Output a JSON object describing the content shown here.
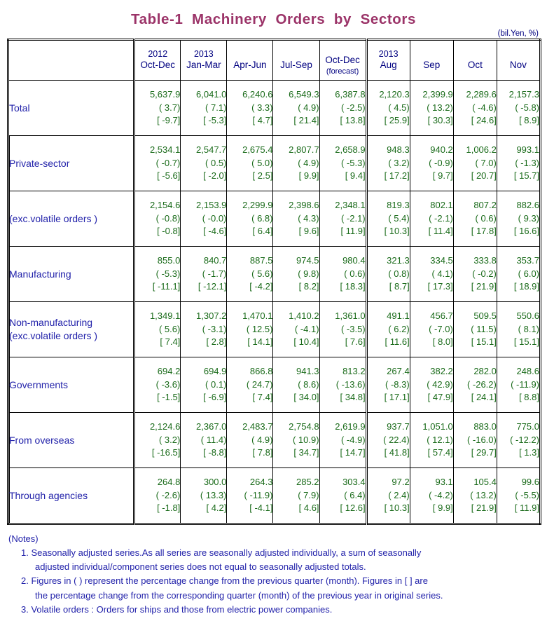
{
  "title": "Table-1  Machinery  Orders  by  Sectors",
  "unit_note": "(bil.Yen, %)",
  "header": {
    "blank": "",
    "columns": [
      {
        "year": "2012",
        "period": "Oct-Dec",
        "note": ""
      },
      {
        "year": "2013",
        "period": "Jan-Mar",
        "note": ""
      },
      {
        "year": "",
        "period": "Apr-Jun",
        "note": ""
      },
      {
        "year": "",
        "period": "Jul-Sep",
        "note": ""
      },
      {
        "year": "",
        "period": "Oct-Dec",
        "note": "(forecast)"
      },
      {
        "year": "2013",
        "period": "Aug",
        "note": ""
      },
      {
        "year": "",
        "period": "Sep",
        "note": ""
      },
      {
        "year": "",
        "period": "Oct",
        "note": ""
      },
      {
        "year": "",
        "period": "Nov",
        "note": ""
      }
    ]
  },
  "rows": [
    {
      "id": "total",
      "label": "Total",
      "label2": "",
      "indent": 0,
      "cells": [
        {
          "v": "5,637.9",
          "p": "( 3.7)",
          "b": "[ -9.7]"
        },
        {
          "v": "6,041.0",
          "p": "( 7.1)",
          "b": "[ -5.3]"
        },
        {
          "v": "6,240.6",
          "p": "( 3.3)",
          "b": "[ 4.7]"
        },
        {
          "v": "6,549.3",
          "p": "( 4.9)",
          "b": "[ 21.4]"
        },
        {
          "v": "6,387.8",
          "p": "( -2.5)",
          "b": "[ 13.8]"
        },
        {
          "v": "2,120.3",
          "p": "( 4.5)",
          "b": "[ 25.9]"
        },
        {
          "v": "2,399.9",
          "p": "( 13.2)",
          "b": "[ 30.3]"
        },
        {
          "v": "2,289.6",
          "p": "( -4.6)",
          "b": "[ 24.6]"
        },
        {
          "v": "2,157.3",
          "p": "( -5.8)",
          "b": "[ 8.9]"
        }
      ]
    },
    {
      "id": "private-sector",
      "label": "Private-sector",
      "label2": "",
      "indent": 1,
      "cells": [
        {
          "v": "2,534.1",
          "p": "( -0.7)",
          "b": "[ -5.6]"
        },
        {
          "v": "2,547.7",
          "p": "( 0.5)",
          "b": "[ -2.0]"
        },
        {
          "v": "2,675.4",
          "p": "( 5.0)",
          "b": "[ 2.5]"
        },
        {
          "v": "2,807.7",
          "p": "( 4.9)",
          "b": "[ 9.9]"
        },
        {
          "v": "2,658.9",
          "p": "( -5.3)",
          "b": "[ 9.4]"
        },
        {
          "v": "948.3",
          "p": "( 3.2)",
          "b": "[ 17.2]"
        },
        {
          "v": "940.2",
          "p": "( -0.9)",
          "b": "[ 9.7]"
        },
        {
          "v": "1,006.2",
          "p": "( 7.0)",
          "b": "[ 20.7]"
        },
        {
          "v": "993.1",
          "p": "( -1.3)",
          "b": "[ 15.7]"
        }
      ]
    },
    {
      "id": "private-sector-exc-volatile",
      "label": "(exc.volatile orders )",
      "label2": "",
      "indent": 1,
      "cells": [
        {
          "v": "2,154.6",
          "p": "( -0.8)",
          "b": "[ -0.8]"
        },
        {
          "v": "2,153.9",
          "p": "( -0.0)",
          "b": "[ -4.6]"
        },
        {
          "v": "2,299.9",
          "p": "( 6.8)",
          "b": "[ 6.4]"
        },
        {
          "v": "2,398.6",
          "p": "( 4.3)",
          "b": "[ 9.6]"
        },
        {
          "v": "2,348.1",
          "p": "( -2.1)",
          "b": "[ 11.9]"
        },
        {
          "v": "819.3",
          "p": "( 5.4)",
          "b": "[ 10.3]"
        },
        {
          "v": "802.1",
          "p": "( -2.1)",
          "b": "[ 11.4]"
        },
        {
          "v": "807.2",
          "p": "( 0.6)",
          "b": "[ 17.8]"
        },
        {
          "v": "882.6",
          "p": "( 9.3)",
          "b": "[ 16.6]"
        }
      ]
    },
    {
      "id": "manufacturing",
      "label": "Manufacturing",
      "label2": "",
      "indent": 2,
      "cells": [
        {
          "v": "855.0",
          "p": "( -5.3)",
          "b": "[ -11.1]"
        },
        {
          "v": "840.7",
          "p": "( -1.7)",
          "b": "[ -12.1]"
        },
        {
          "v": "887.5",
          "p": "( 5.6)",
          "b": "[ -4.2]"
        },
        {
          "v": "974.5",
          "p": "( 9.8)",
          "b": "[ 8.2]"
        },
        {
          "v": "980.4",
          "p": "( 0.6)",
          "b": "[ 18.3]"
        },
        {
          "v": "321.3",
          "p": "( 0.8)",
          "b": "[ 8.7]"
        },
        {
          "v": "334.5",
          "p": "( 4.1)",
          "b": "[ 17.3]"
        },
        {
          "v": "333.8",
          "p": "( -0.2)",
          "b": "[ 21.9]"
        },
        {
          "v": "353.7",
          "p": "( 6.0)",
          "b": "[ 18.9]"
        }
      ]
    },
    {
      "id": "non-manufacturing",
      "label": "Non-manufacturing",
      "label2": "(exc.volatile orders )",
      "indent": 2,
      "cells": [
        {
          "v": "1,349.1",
          "p": "( 5.6)",
          "b": "[ 7.4]"
        },
        {
          "v": "1,307.2",
          "p": "( -3.1)",
          "b": "[ 2.8]"
        },
        {
          "v": "1,470.1",
          "p": "( 12.5)",
          "b": "[ 14.1]"
        },
        {
          "v": "1,410.2",
          "p": "( -4.1)",
          "b": "[ 10.4]"
        },
        {
          "v": "1,361.0",
          "p": "( -3.5)",
          "b": "[ 7.6]"
        },
        {
          "v": "491.1",
          "p": "( 6.2)",
          "b": "[ 11.6]"
        },
        {
          "v": "456.7",
          "p": "( -7.0)",
          "b": "[ 8.0]"
        },
        {
          "v": "509.5",
          "p": "( 11.5)",
          "b": "[ 15.1]"
        },
        {
          "v": "550.6",
          "p": "( 8.1)",
          "b": "[ 15.1]"
        }
      ]
    },
    {
      "id": "governments",
      "label": "Governments",
      "label2": "",
      "indent": 1,
      "cells": [
        {
          "v": "694.2",
          "p": "( -3.6)",
          "b": "[ -1.5]"
        },
        {
          "v": "694.9",
          "p": "( 0.1)",
          "b": "[ -6.9]"
        },
        {
          "v": "866.8",
          "p": "( 24.7)",
          "b": "[ 7.4]"
        },
        {
          "v": "941.3",
          "p": "( 8.6)",
          "b": "[ 34.0]"
        },
        {
          "v": "813.2",
          "p": "( -13.6)",
          "b": "[ 34.8]"
        },
        {
          "v": "267.4",
          "p": "( -8.3)",
          "b": "[ 17.1]"
        },
        {
          "v": "382.2",
          "p": "( 42.9)",
          "b": "[ 47.9]"
        },
        {
          "v": "282.0",
          "p": "( -26.2)",
          "b": "[ 24.1]"
        },
        {
          "v": "248.6",
          "p": "( -11.9)",
          "b": "[ 8.8]"
        }
      ]
    },
    {
      "id": "from-overseas",
      "label": "From overseas",
      "label2": "",
      "indent": 1,
      "cells": [
        {
          "v": "2,124.6",
          "p": "( 3.2)",
          "b": "[ -16.5]"
        },
        {
          "v": "2,367.0",
          "p": "( 11.4)",
          "b": "[ -8.8]"
        },
        {
          "v": "2,483.7",
          "p": "( 4.9)",
          "b": "[ 7.8]"
        },
        {
          "v": "2,754.8",
          "p": "( 10.9)",
          "b": "[ 34.7]"
        },
        {
          "v": "2,619.9",
          "p": "( -4.9)",
          "b": "[ 14.7]"
        },
        {
          "v": "937.7",
          "p": "( 22.4)",
          "b": "[ 41.8]"
        },
        {
          "v": "1,051.0",
          "p": "( 12.1)",
          "b": "[ 57.4]"
        },
        {
          "v": "883.0",
          "p": "( -16.0)",
          "b": "[ 29.7]"
        },
        {
          "v": "775.0",
          "p": "( -12.2)",
          "b": "[ 1.3]"
        }
      ]
    },
    {
      "id": "through-agencies",
      "label": "Through agencies",
      "label2": "",
      "indent": 1,
      "cells": [
        {
          "v": "264.8",
          "p": "( -2.6)",
          "b": "[ -1.8]"
        },
        {
          "v": "300.0",
          "p": "( 13.3)",
          "b": "[ 4.2]"
        },
        {
          "v": "264.3",
          "p": "( -11.9)",
          "b": "[ -4.1]"
        },
        {
          "v": "285.2",
          "p": "( 7.9)",
          "b": "[ 4.6]"
        },
        {
          "v": "303.4",
          "p": "( 6.4)",
          "b": "[ 12.6]"
        },
        {
          "v": "97.2",
          "p": "( 2.4)",
          "b": "[ 10.3]"
        },
        {
          "v": "93.1",
          "p": "( -4.2)",
          "b": "[ 9.9]"
        },
        {
          "v": "105.4",
          "p": "( 13.2)",
          "b": "[ 21.9]"
        },
        {
          "v": "99.6",
          "p": "( -5.5)",
          "b": "[ 11.9]"
        }
      ]
    }
  ],
  "notes": {
    "heading": "(Notes)",
    "items": [
      {
        "line1": "1. Seasonally adjusted series.As all series are seasonally adjusted individually, a sum of seasonally",
        "line2": "adjusted individual/component series does not equal to seasonally adjusted totals."
      },
      {
        "line1": "2. Figures in ( ) represent the percentage change from the previous quarter (month). Figures in [ ] are",
        "line2": "the percentage change from the corresponding quarter (month) of the previous year in original series."
      },
      {
        "line1": "3. Volatile orders : Orders for ships and those from electric power companies.",
        "line2": ""
      }
    ]
  },
  "colors": {
    "title": "#9B3368",
    "label_text": "#2222AA",
    "header_text": "#000080",
    "data_text": "#1a6b1a",
    "border": "#000000",
    "background": "#FFFFFF"
  }
}
